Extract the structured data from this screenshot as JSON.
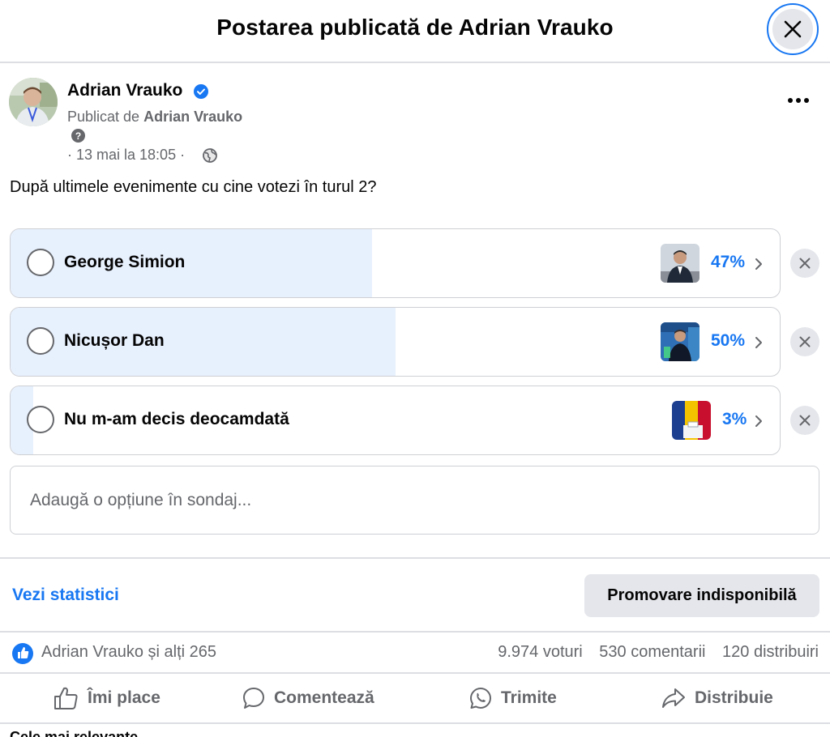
{
  "header": {
    "title": "Postarea publicată de Adrian Vrauko"
  },
  "post": {
    "author": "Adrian Vrauko",
    "published_prefix": "Publicat de",
    "published_by": "Adrian Vrauko",
    "time": "· 13 mai la 18:05 ·",
    "question": "După ultimele evenimente cu cine votezi în turul 2?"
  },
  "poll": {
    "options": [
      {
        "label": "George Simion",
        "percent_text": "47%",
        "percent": 47
      },
      {
        "label": "Nicușor Dan",
        "percent_text": "50%",
        "percent": 50
      },
      {
        "label": "Nu m-am decis deocamdată",
        "percent_text": "3%",
        "percent": 3
      }
    ],
    "add_placeholder": "Adaugă o opțiune în sondaj..."
  },
  "actions_bar": {
    "stats_link": "Vezi statistici",
    "promote_button": "Promovare indisponibilă"
  },
  "engagement": {
    "likes": "Adrian Vrauko și alți 265",
    "votes": "9.974 voturi",
    "comments": "530 comentarii",
    "shares": "120 distribuiri"
  },
  "buttons": {
    "like": "Îmi place",
    "comment": "Comentează",
    "send": "Trimite",
    "share": "Distribuie"
  },
  "comments_header": "Cele mai relevante",
  "colors": {
    "accent": "#1877f2",
    "fill": "#e7f0fd",
    "muted": "#65676b"
  }
}
